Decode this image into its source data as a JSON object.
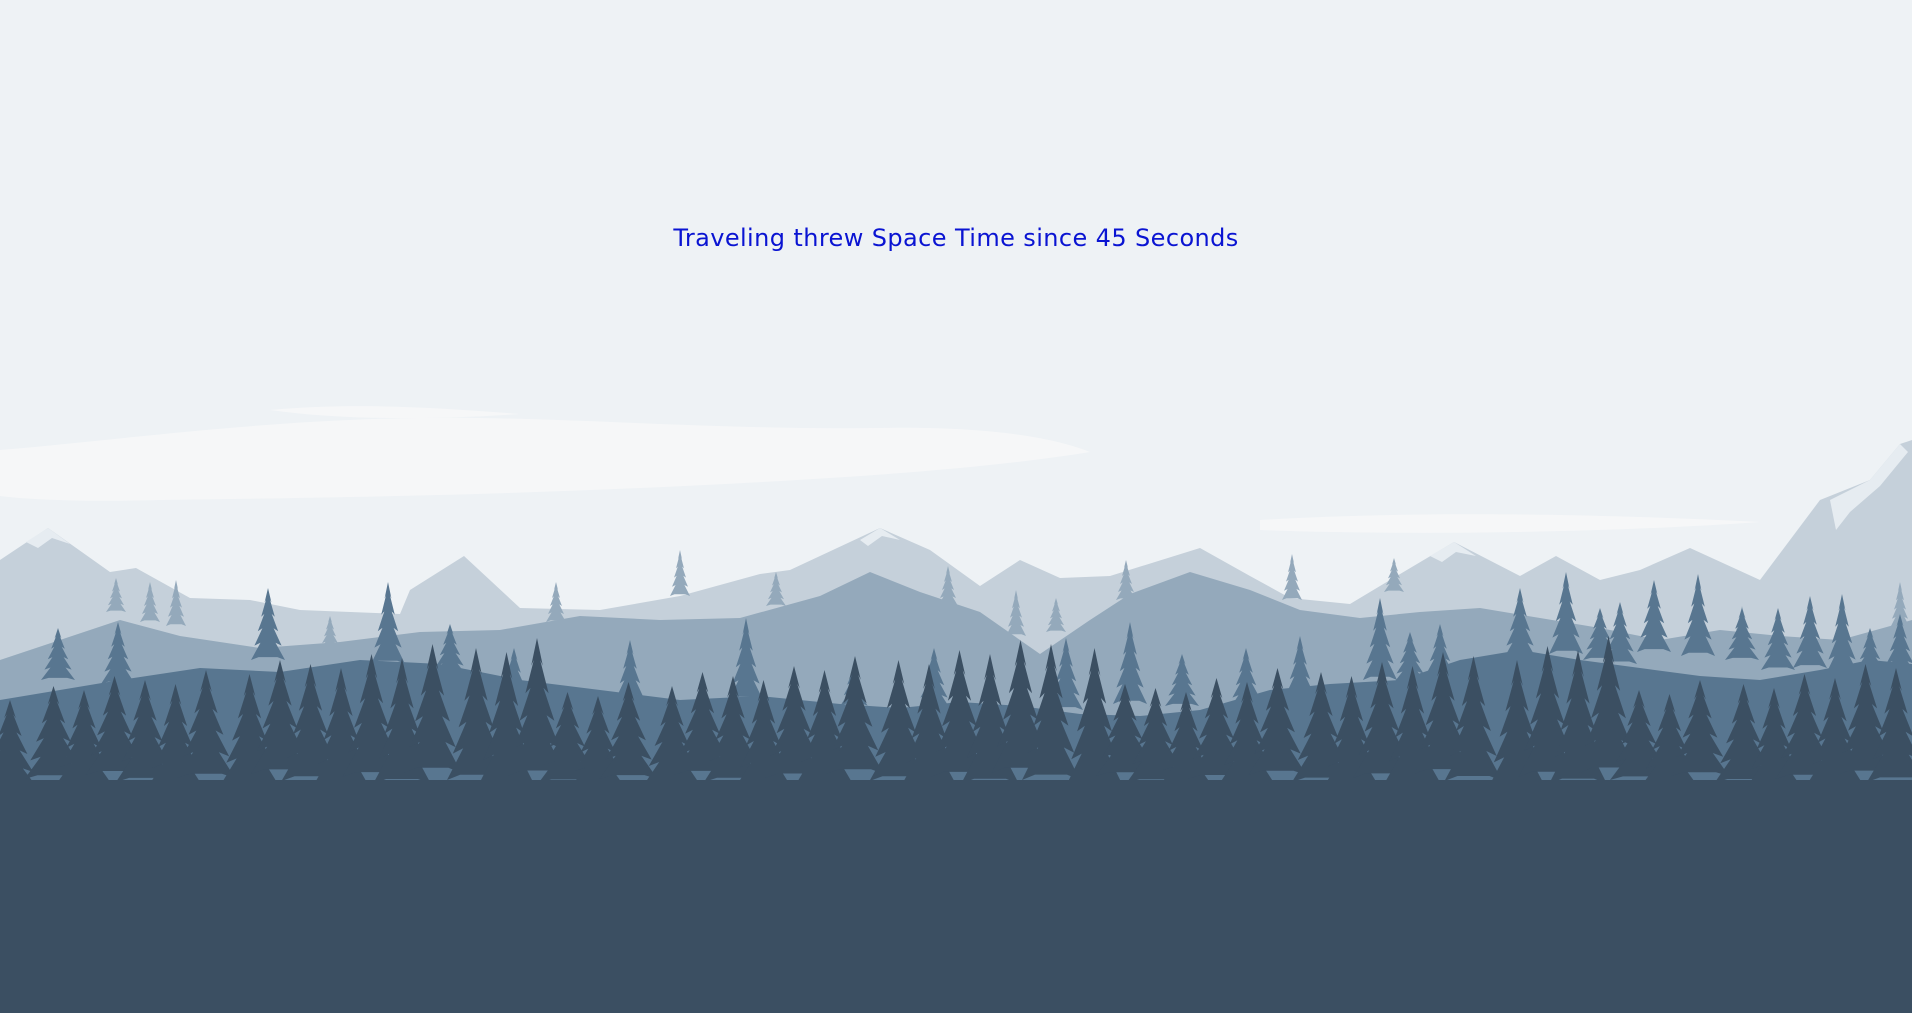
{
  "status": {
    "text": "Traveling threw Space Time since 45 Seconds",
    "color": "#0a14d2"
  },
  "scene": {
    "sky_color": "#eef2f5",
    "cloud_color": "#f6f7f8",
    "far_mountain_color": "#c5d0da",
    "snow_color": "#e6ecf1",
    "mid_hill_color": "#94a9bb",
    "near_hill_color": "#587690",
    "forest_color": "#3b4f62"
  }
}
